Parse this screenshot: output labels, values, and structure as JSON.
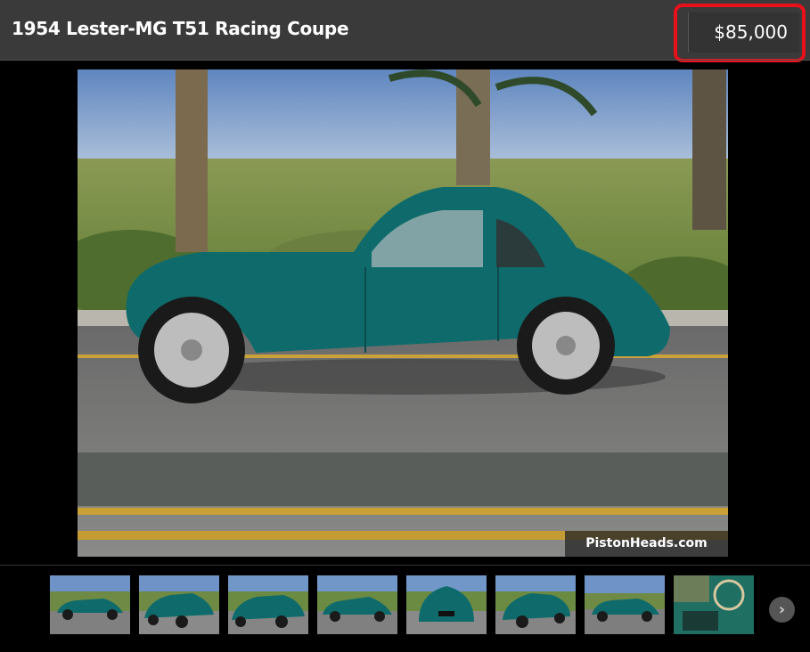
{
  "listing": {
    "title": "1954 Lester-MG T51 Racing Coupe",
    "price": "$85,000"
  },
  "photo": {
    "watermark": "PistonHeads.com",
    "car_color": "#0f6b6b"
  },
  "thumbnails": [
    {
      "label": "side-view-left"
    },
    {
      "label": "front-three-quarter"
    },
    {
      "label": "front-three-quarter-2"
    },
    {
      "label": "side-view-right"
    },
    {
      "label": "rear-view"
    },
    {
      "label": "rear-three-quarter"
    },
    {
      "label": "side-view-left-2"
    },
    {
      "label": "interior-steering-wheel"
    }
  ],
  "colors": {
    "header_bg": "#3a3a3a",
    "highlight": "#e8101a",
    "car": "#0f6b6b"
  },
  "nav": {
    "next_icon": "chevron-right-icon"
  }
}
